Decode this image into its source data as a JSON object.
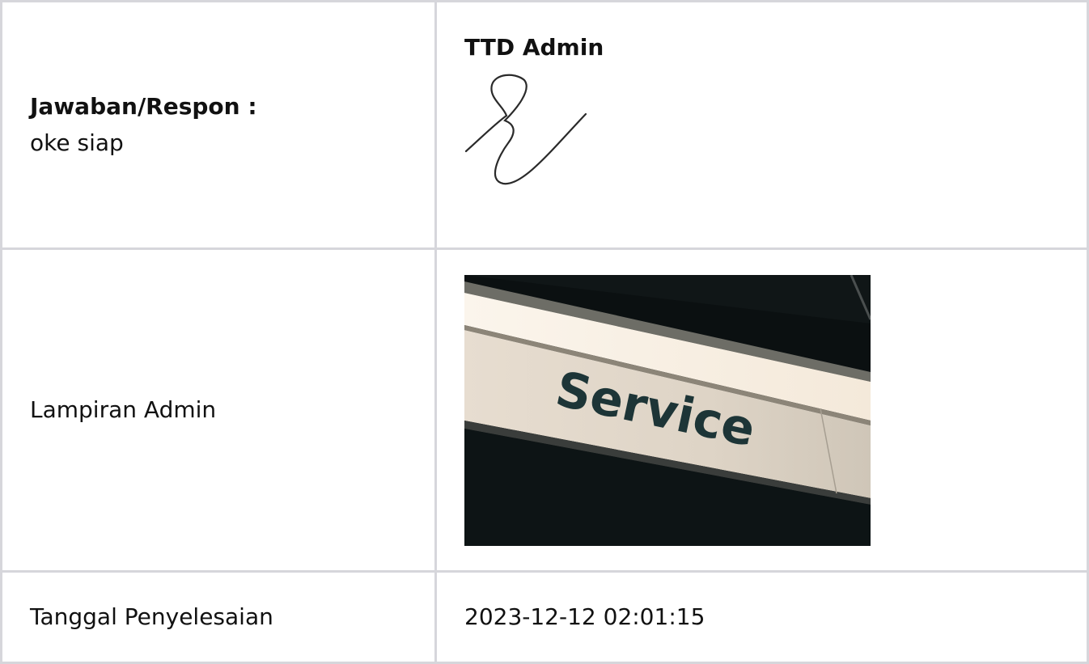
{
  "response": {
    "label": "Jawaban/Respon :",
    "value": "oke siap"
  },
  "signature": {
    "title": "TTD Admin",
    "icon": "signature-scribble"
  },
  "attachment": {
    "label": "Lampiran Admin",
    "photo_text": "Service"
  },
  "completion": {
    "label": "Tanggal Penyelesaian",
    "value": "2023-12-12 02:01:15"
  },
  "colors": {
    "border": "#d6d6db",
    "text": "#111111"
  }
}
